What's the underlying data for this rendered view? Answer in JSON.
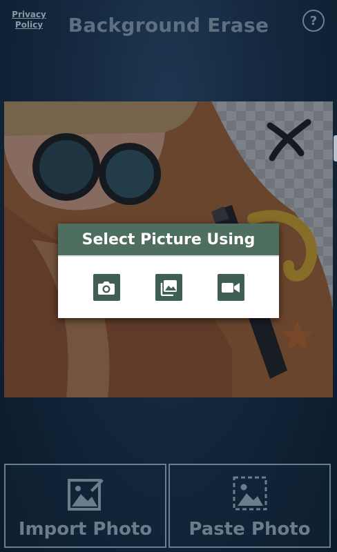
{
  "header": {
    "privacy_label": "Privacy Policy",
    "title": "Background Erase",
    "help_label": "?"
  },
  "dialog": {
    "title": "Select Picture Using",
    "options": [
      {
        "icon": "camera-icon"
      },
      {
        "icon": "gallery-icon"
      },
      {
        "icon": "video-icon"
      }
    ]
  },
  "buttons": {
    "import_label": "Import Photo",
    "paste_label": "Paste Photo"
  },
  "colors": {
    "dialog_header": "#4e6e60",
    "dialog_icon_bg": "#3f5f53",
    "muted_text": "#6b7c8b"
  }
}
